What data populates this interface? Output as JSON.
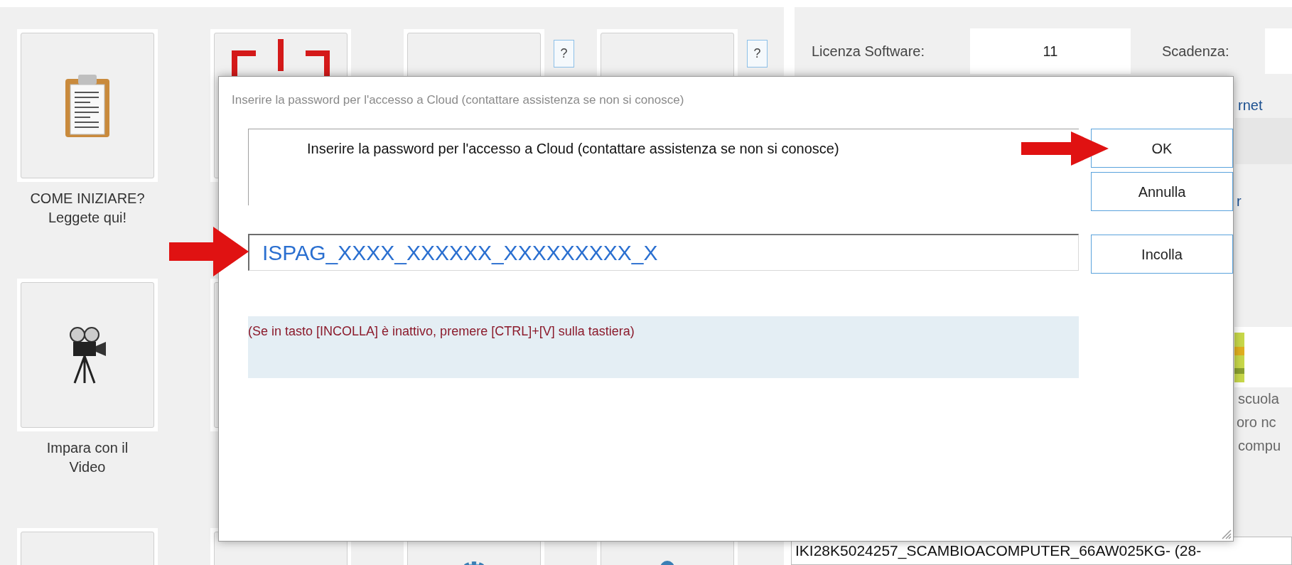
{
  "launcher": {
    "rows": [
      [
        {
          "kind": "clipboard",
          "label": "COME INIZIARE? Leggete qui!"
        },
        {
          "kind": "logo"
        },
        {
          "kind": "blank",
          "help": "?"
        },
        {
          "kind": "blank",
          "help": "?"
        }
      ],
      [
        {
          "kind": "camera",
          "label": "Impara con il Video"
        },
        {
          "kind": "blank"
        }
      ],
      [
        {
          "kind": "blank"
        },
        {
          "kind": "blank"
        },
        {
          "kind": "gear"
        },
        {
          "kind": "person"
        }
      ]
    ]
  },
  "right_panel": {
    "license_label": "Licenza Software:",
    "license_value": "11",
    "expiry_label": "Scadenza:",
    "link_fragment": "rnet",
    "fragment": "r",
    "description_lines": [
      "scuola",
      "oro nc",
      "compu"
    ],
    "code_field": "IKI28K5024257_SCAMBIOACOMPUTER_66AW025KG- (28-"
  },
  "dialog": {
    "title": "Inserire la password per l'accesso a Cloud (contattare assistenza se non si conosce)",
    "prompt": "Inserire la password per l'accesso a Cloud (contattare assistenza se non si conosce)",
    "password_field": {
      "value": "ISPAG_XXXX_XXXXXX_XXXXXXXXX_X"
    },
    "buttons": [
      "OK",
      "Annulla",
      "Incolla"
    ],
    "hint": "(Se in tasto [INCOLLA] è inattivo, premere [CTRL]+[V] sulla tastiera)"
  }
}
